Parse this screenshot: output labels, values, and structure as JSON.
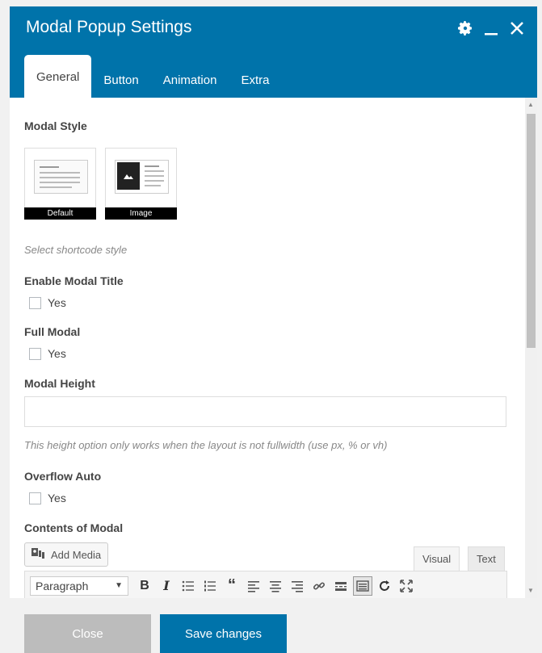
{
  "header": {
    "title": "Modal Popup Settings",
    "icons": [
      "gear-icon",
      "minimize-icon",
      "close-icon"
    ]
  },
  "tabs": [
    {
      "label": "General",
      "active": true
    },
    {
      "label": "Button",
      "active": false
    },
    {
      "label": "Animation",
      "active": false
    },
    {
      "label": "Extra",
      "active": false
    }
  ],
  "general": {
    "modal_style": {
      "label": "Modal Style",
      "options": [
        {
          "caption": "Default",
          "icon": "layout-default-icon"
        },
        {
          "caption": "Image",
          "icon": "layout-image-icon"
        }
      ],
      "help": "Select shortcode style"
    },
    "enable_title": {
      "label": "Enable Modal Title",
      "option": "Yes",
      "checked": false
    },
    "full_modal": {
      "label": "Full Modal",
      "option": "Yes",
      "checked": false
    },
    "modal_height": {
      "label": "Modal Height",
      "value": "",
      "help": "This height option only works when the layout is not fullwidth (use px, % or vh)"
    },
    "overflow_auto": {
      "label": "Overflow Auto",
      "option": "Yes",
      "checked": false
    },
    "contents": {
      "label": "Contents of Modal",
      "add_media": "Add Media",
      "editor_tabs": [
        "Visual",
        "Text"
      ],
      "format_select": "Paragraph"
    }
  },
  "footer": {
    "close_label": "Close",
    "save_label": "Save changes"
  },
  "colors": {
    "accent": "#0073aa",
    "close_button": "#bcbcbc"
  }
}
